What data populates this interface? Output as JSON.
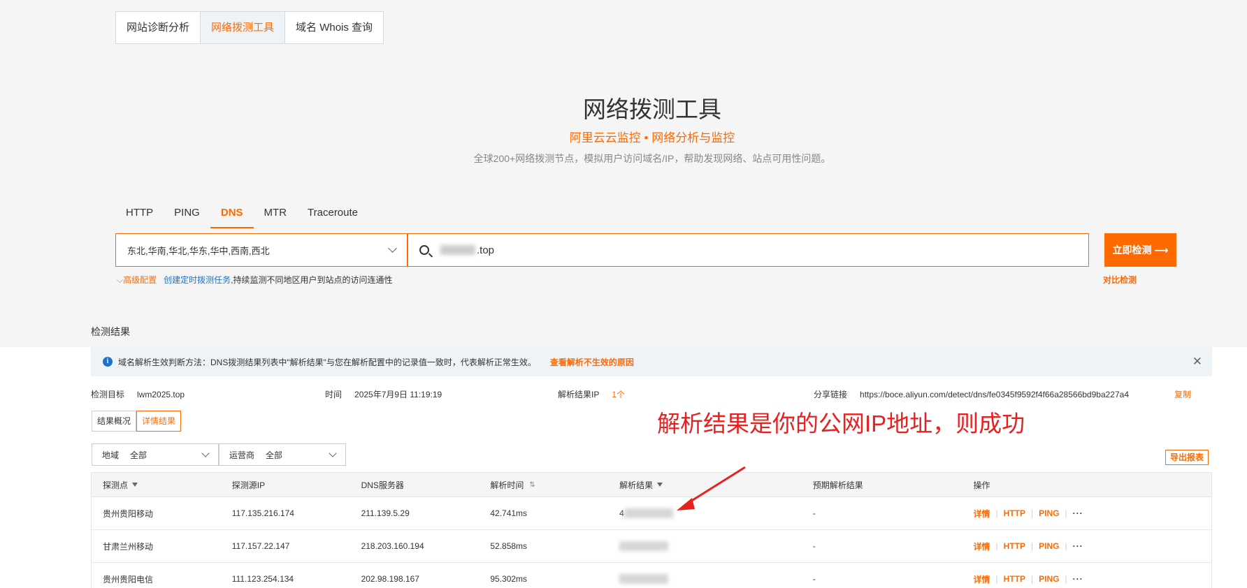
{
  "top_tabs": [
    {
      "label": "网站诊断分析"
    },
    {
      "label": "网络拨测工具"
    },
    {
      "label": "域名 Whois 查询"
    }
  ],
  "hero": {
    "title": "网络拨测工具",
    "subtitle": "阿里云云监控 • 网络分析与监控",
    "description": "全球200+网络拨测节点，模拟用户访问域名/IP，帮助发现网络、站点可用性问题。"
  },
  "protocol_tabs": [
    {
      "label": "HTTP"
    },
    {
      "label": "PING"
    },
    {
      "label": "DNS"
    },
    {
      "label": "MTR"
    },
    {
      "label": "Traceroute"
    }
  ],
  "search": {
    "regions": "东北,华南,华北,华东,华中,西南,西北",
    "domain_prefix": "",
    "domain_suffix": ".top",
    "detect_button": "立即检测 ⟶",
    "advanced": "高级配置",
    "schedule_link": "创建定时拨测任务",
    "schedule_text": ",持续监测不同地区用户到站点的访问连通性",
    "compare": "对比检测"
  },
  "results": {
    "title": "检测结果",
    "notice": "域名解析生效判断方法：DNS拨测结果列表中\"解析结果\"与您在解析配置中的记录值一致时，代表解析正常生效。",
    "notice_link": "查看解析不生效的原因",
    "meta": {
      "target_label": "检测目标",
      "target_value": "lwm2025.top",
      "time_label": "时间",
      "time_value": "2025年7月9日 11:19:19",
      "ip_label": "解析结果IP",
      "ip_value": "1个",
      "share_label": "分享链接",
      "share_value": "https://boce.aliyun.com/detect/dns/fe0345f9592f4f66a28566bd9ba227a4",
      "copy": "复制"
    },
    "view_toggle": {
      "overview": "结果概况",
      "detail": "详情结果"
    },
    "filters": {
      "region_label": "地域",
      "region_value": "全部",
      "isp_label": "运营商",
      "isp_value": "全部"
    },
    "export": "导出报表",
    "annotation": "解析结果是你的公网IP地址，则成功",
    "columns": [
      "探测点",
      "探测源IP",
      "DNS服务器",
      "解析时间",
      "解析结果",
      "预期解析结果",
      "操作"
    ],
    "rows": [
      {
        "point": "贵州贵阳移动",
        "src_ip": "117.135.216.174",
        "dns": "211.139.5.29",
        "time": "42.741ms",
        "result": "4",
        "expected": "-"
      },
      {
        "point": "甘肃兰州移动",
        "src_ip": "117.157.22.147",
        "dns": "218.203.160.194",
        "time": "52.858ms",
        "result": "",
        "expected": "-"
      },
      {
        "point": "贵州贵阳电信",
        "src_ip": "111.123.254.134",
        "dns": "202.98.198.167",
        "time": "95.302ms",
        "result": "",
        "expected": "-"
      }
    ],
    "ops": {
      "detail": "详情",
      "http": "HTTP",
      "ping": "PING",
      "more": "···"
    }
  },
  "colors": {
    "accent": "#ff6a00",
    "link": "#1a73c8",
    "annotation": "#e82020"
  }
}
